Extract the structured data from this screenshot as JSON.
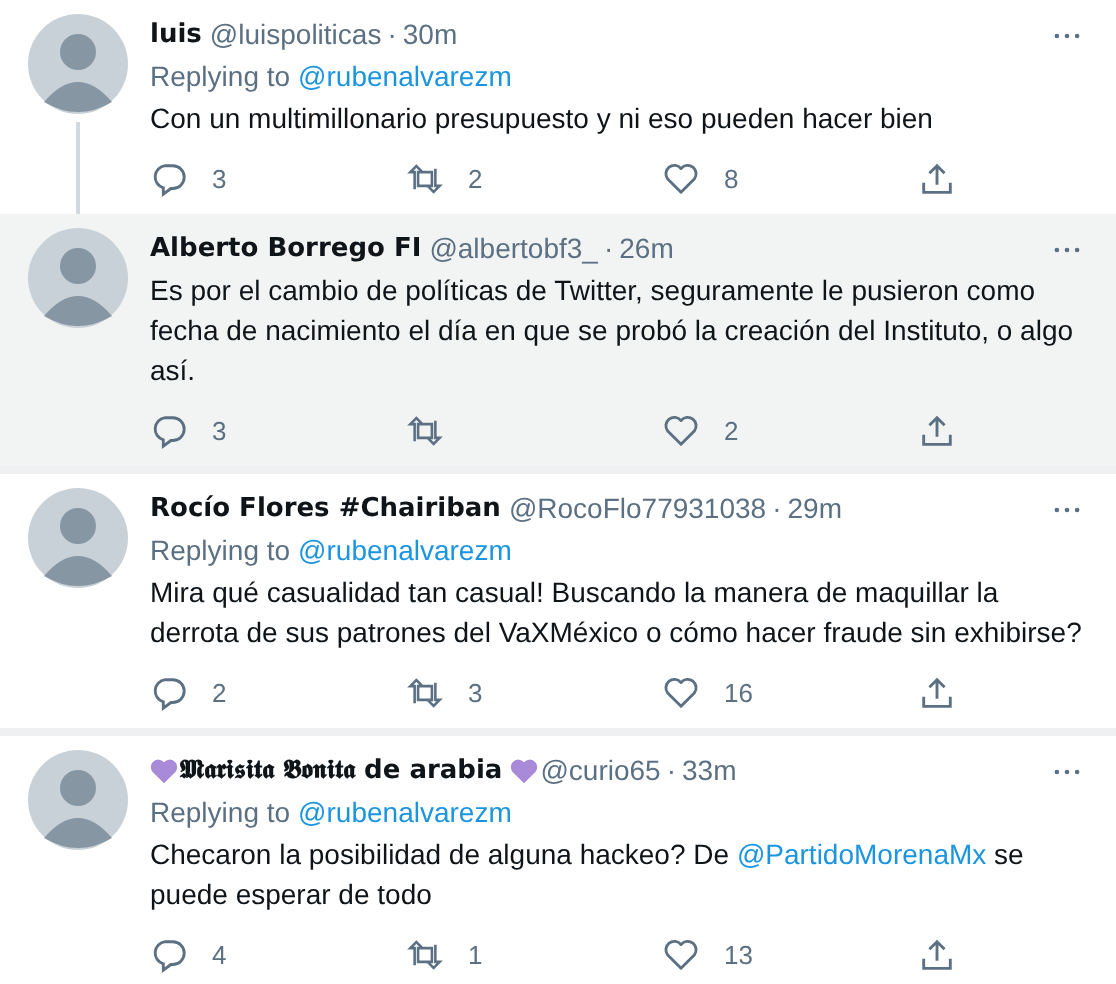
{
  "meta_separator": "·",
  "tweets": [
    {
      "name": "luis",
      "name_hearts": false,
      "handle": "@luispoliticas",
      "time": "30m",
      "replying_label": "Replying to",
      "replying_to": "@rubenalvarezm",
      "highlighted": false,
      "thread_below": true,
      "text": [
        {
          "kind": "plain",
          "text": "Con un multimillonario presupuesto y ni eso pueden hacer bien"
        }
      ],
      "replies": "3",
      "retweets": "2",
      "likes": "8"
    },
    {
      "name": "Alberto Borrego FI",
      "name_hearts": false,
      "handle": "@albertobf3_",
      "time": "26m",
      "highlighted": true,
      "thread_below": false,
      "text": [
        {
          "kind": "plain",
          "text": "Es por el cambio de políticas de Twitter, seguramente le pusieron como fecha de nacimiento el día en que se probó la creación del Instituto, o algo así."
        }
      ],
      "replies": "3",
      "likes": "2"
    },
    {
      "name": "Rocío Flores #Chairiban",
      "name_hearts": false,
      "handle": "@RocoFlo77931038",
      "time": "29m",
      "replying_label": "Replying to",
      "replying_to": "@rubenalvarezm",
      "highlighted": false,
      "thread_below": false,
      "text": [
        {
          "kind": "plain",
          "text": "Mira qué casualidad tan casual! Buscando la manera de maquillar la derrota de sus patrones del VaXMéxico o cómo hacer fraude sin exhibirse?"
        }
      ],
      "replies": "2",
      "retweets": "3",
      "likes": "16"
    },
    {
      "name": "𝕸𝖆𝖗𝖎𝖘𝖎𝖙𝖆 𝕭𝖔𝖓𝖎𝖙𝖆 de arabia",
      "name_hearts": true,
      "handle": "@curio65",
      "time": "33m",
      "replying_label": "Replying to",
      "replying_to": "@rubenalvarezm",
      "highlighted": false,
      "thread_below": false,
      "text": [
        {
          "kind": "plain",
          "text": "Checaron la posibilidad de alguna hackeo? De "
        },
        {
          "kind": "mention",
          "text": "@PartidoMorenaMx"
        },
        {
          "kind": "plain",
          "text": " se puede esperar de todo"
        }
      ],
      "replies": "4",
      "retweets": "1",
      "likes": "13"
    }
  ]
}
